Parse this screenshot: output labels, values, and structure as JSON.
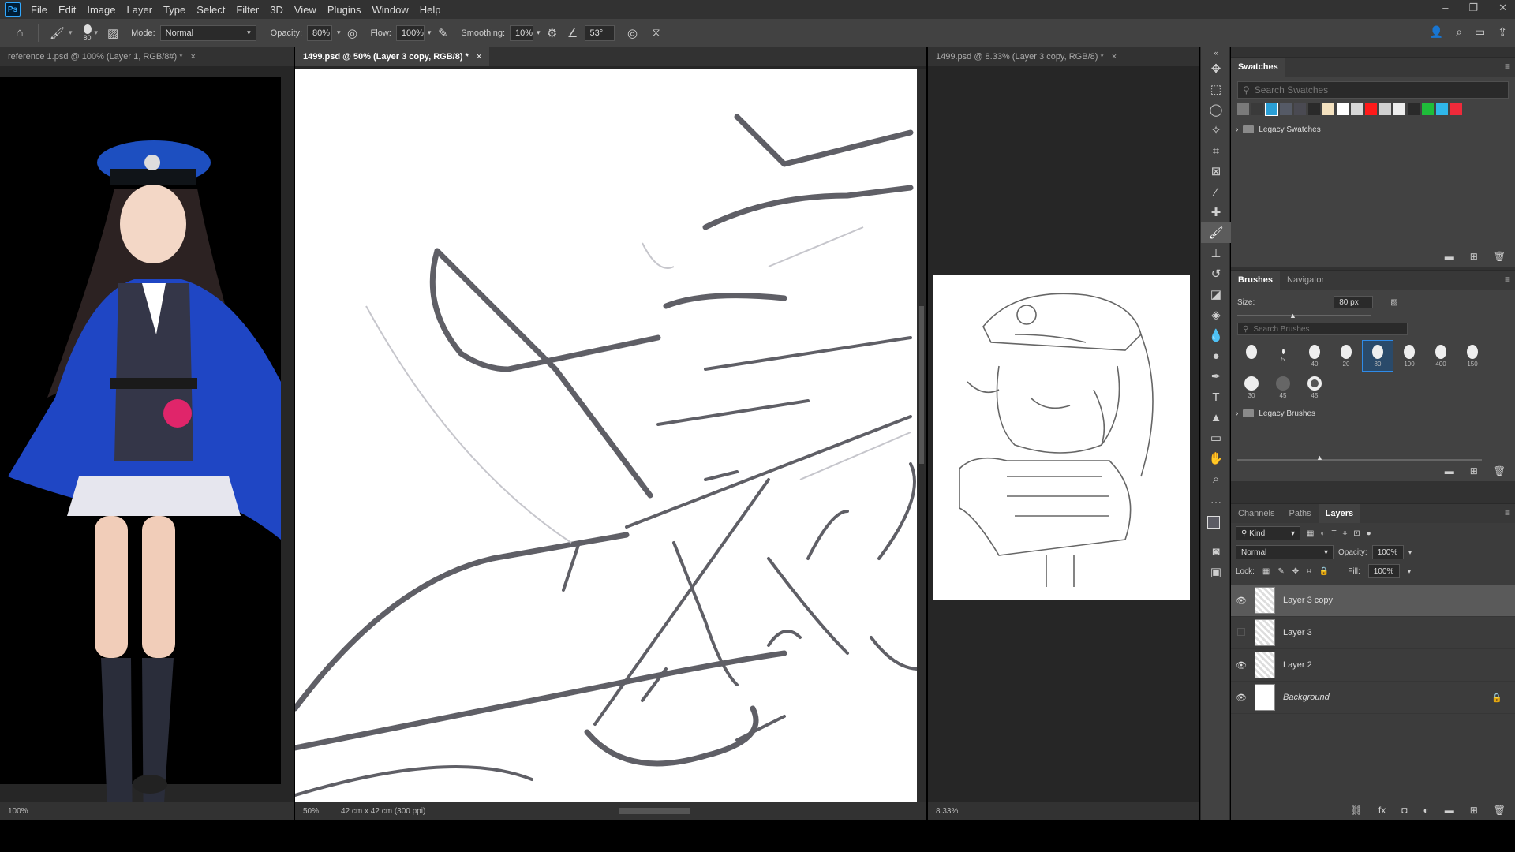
{
  "menubar": {
    "logo": "Ps",
    "items": [
      "File",
      "Edit",
      "Image",
      "Layer",
      "Type",
      "Select",
      "Filter",
      "3D",
      "View",
      "Plugins",
      "Window",
      "Help"
    ]
  },
  "options": {
    "brush_size": "80",
    "mode_label": "Mode:",
    "mode_value": "Normal",
    "opacity_label": "Opacity:",
    "opacity_value": "80%",
    "flow_label": "Flow:",
    "flow_value": "100%",
    "smoothing_label": "Smoothing:",
    "smoothing_value": "10%",
    "angle_value": "53°"
  },
  "docs": {
    "left": {
      "title": "reference 1.psd @ 100% (Layer 1, RGB/8#) *",
      "zoom": "100%"
    },
    "center": {
      "title": "1499.psd @ 50% (Layer 3 copy, RGB/8) *",
      "zoom": "50%",
      "size": "42 cm x 42 cm (300 ppi)"
    },
    "right": {
      "title": "1499.psd @ 8.33% (Layer 3 copy, RGB/8) *",
      "zoom": "8.33%"
    },
    "close": "×"
  },
  "swatches": {
    "tab": "Swatches",
    "search_placeholder": "Search Swatches",
    "colors": [
      "#7a7a7a",
      "#3a3a3a",
      "#2a9fd6",
      "#555a66",
      "#4a4a52",
      "#2a2a2a",
      "#f4e2c0",
      "#ffffff",
      "#d7d7d7",
      "#ff1a1a",
      "#d0d0d0",
      "#ededed",
      "#2a2a2a",
      "#1fbd3a",
      "#2fb7ea",
      "#ef2a3a"
    ],
    "folder": "Legacy Swatches"
  },
  "brushes": {
    "tabs": [
      "Brushes",
      "Navigator"
    ],
    "size_label": "Size:",
    "size_value": "80 px",
    "search_placeholder": "Search Brushes",
    "presets": [
      "",
      "5",
      "40",
      "20",
      "80",
      "100",
      "400",
      "150",
      "30",
      "45",
      "45"
    ],
    "folder": "Legacy Brushes"
  },
  "layers": {
    "tabs": [
      "Channels",
      "Paths",
      "Layers"
    ],
    "kind": "Kind",
    "blend": "Normal",
    "opacity_label": "Opacity:",
    "opacity_value": "100%",
    "lock_label": "Lock:",
    "fill_label": "Fill:",
    "fill_value": "100%",
    "items": [
      {
        "name": "Layer 3 copy",
        "visible": true,
        "selected": true
      },
      {
        "name": "Layer 3",
        "visible": false,
        "selected": false
      },
      {
        "name": "Layer 2",
        "visible": true,
        "selected": false
      },
      {
        "name": "Background",
        "visible": true,
        "selected": false
      }
    ]
  }
}
